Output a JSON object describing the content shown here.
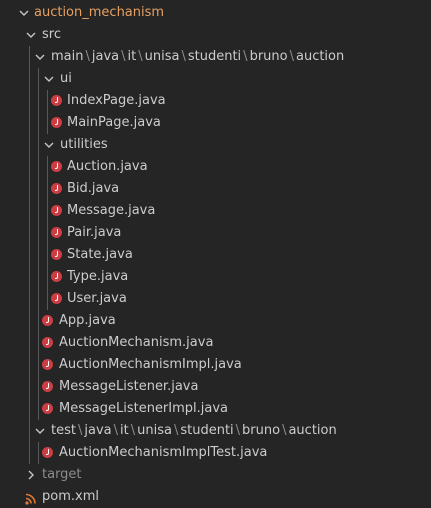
{
  "explorer": {
    "root": {
      "label": "auction_mechanism"
    },
    "src": {
      "label": "src"
    },
    "main_path": {
      "segments": [
        "main",
        "java",
        "it",
        "unisa",
        "studenti",
        "bruno",
        "auction"
      ],
      "separator": "\\"
    },
    "ui": {
      "label": "ui"
    },
    "ui_files": [
      "IndexPage.java",
      "MainPage.java"
    ],
    "utilities": {
      "label": "utilities"
    },
    "utilities_files": [
      "Auction.java",
      "Bid.java",
      "Message.java",
      "Pair.java",
      "State.java",
      "Type.java",
      "User.java"
    ],
    "main_files": [
      "App.java",
      "AuctionMechanism.java",
      "AuctionMechanismImpl.java",
      "MessageListener.java",
      "MessageListenerImpl.java"
    ],
    "test_path": {
      "segments": [
        "test",
        "java",
        "it",
        "unisa",
        "studenti",
        "bruno",
        "auction"
      ],
      "separator": "\\"
    },
    "test_files": [
      "AuctionMechanismImplTest.java"
    ],
    "target": {
      "label": "target"
    },
    "pom": {
      "label": "pom.xml"
    }
  },
  "icons": {
    "chevron_expanded": "chevron-down-icon",
    "chevron_collapsed": "chevron-right-icon",
    "java_file": "java-file-icon",
    "maven_file": "rss-icon"
  },
  "colors": {
    "background": "#252526",
    "text": "#cccccc",
    "root_text": "#e8a060",
    "ignored_text": "#8c8c8c",
    "java_icon": "#cc3e44",
    "maven_icon": "#e37933",
    "indent_guide": "#585858"
  }
}
